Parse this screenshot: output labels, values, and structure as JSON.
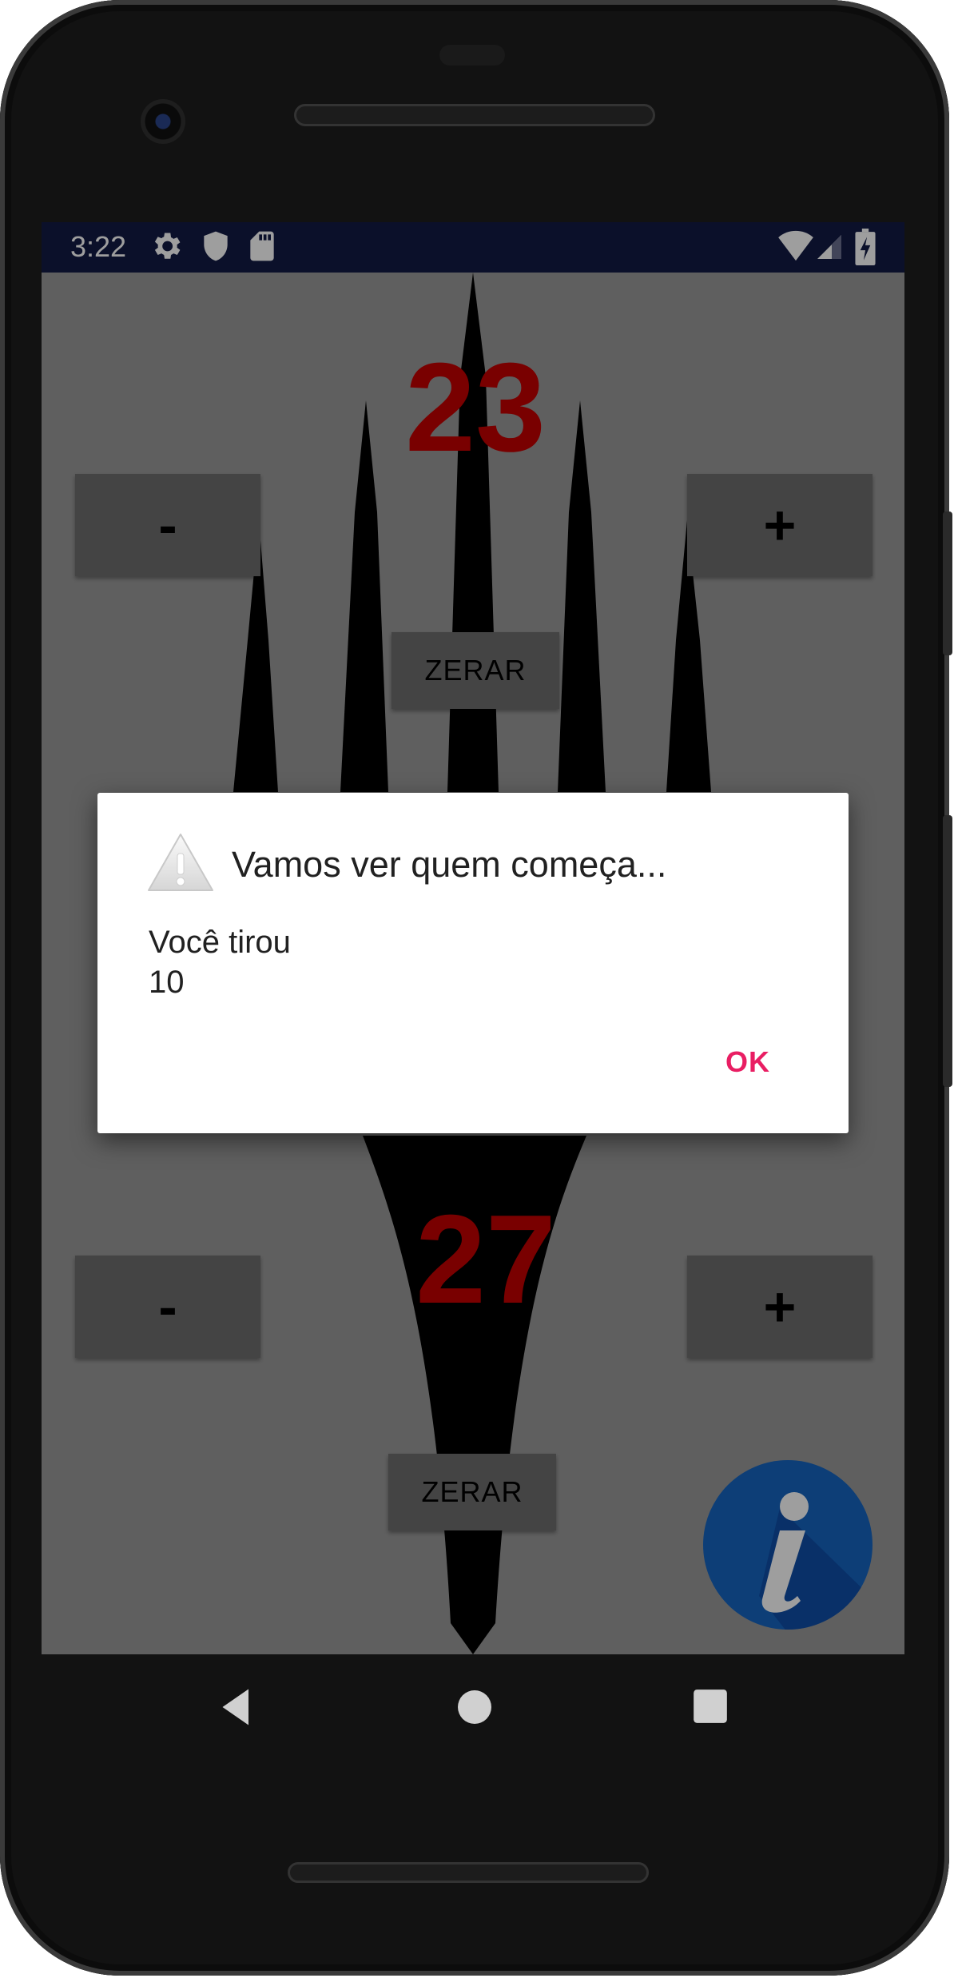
{
  "status_bar": {
    "time": "3:22",
    "left_icons": [
      "gear-icon",
      "shield-icon",
      "sd-card-icon"
    ],
    "right_icons": [
      "wifi-icon",
      "signal-icon",
      "battery-charging-icon"
    ],
    "background": "#121a45"
  },
  "app": {
    "top_player": {
      "score": "23",
      "minus_label": "-",
      "plus_label": "+",
      "reset_label": "ZERAR"
    },
    "bottom_player": {
      "score": "27",
      "minus_label": "-",
      "plus_label": "+",
      "reset_label": "ZERAR"
    },
    "info_button_icon": "info-icon",
    "score_color": "#c40000",
    "button_color": "#6e6e6e"
  },
  "dialog": {
    "icon": "warning-icon",
    "title": "Vamos ver quem começa...",
    "message": "Você tirou\n10",
    "ok_label": "OK",
    "accent_color": "#e91e63"
  },
  "navigation_bar": {
    "buttons": [
      "back-icon",
      "home-icon",
      "recents-icon"
    ]
  }
}
